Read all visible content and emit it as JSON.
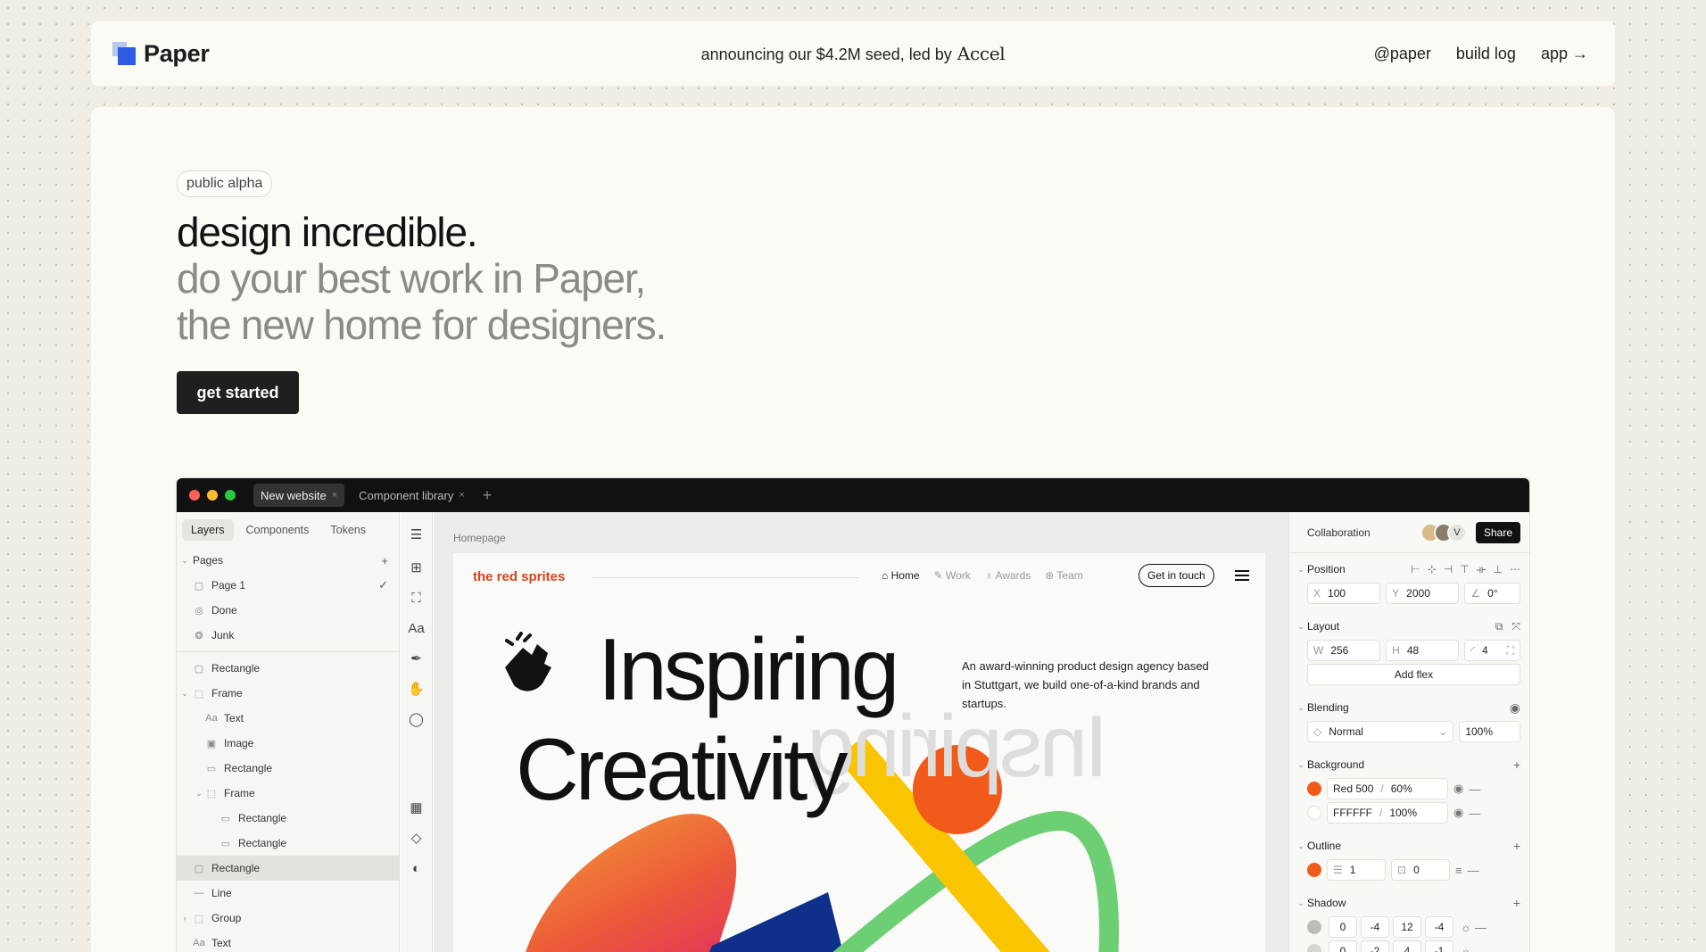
{
  "nav": {
    "brand": "Paper",
    "announce_text": "announcing our $4.2M seed, led by",
    "announce_brand": "Accel",
    "links": [
      "@paper",
      "build log",
      "app →"
    ]
  },
  "hero": {
    "badge": "public alpha",
    "line1": "design incredible.",
    "line2": "do your best work in Paper,",
    "line3": "the new home for designers.",
    "cta": "get started"
  },
  "app": {
    "tabs": [
      {
        "label": "New website",
        "close": "×"
      },
      {
        "label": "Component library",
        "close": "×"
      }
    ],
    "new_tab": "+",
    "left": {
      "tabs": [
        "Layers",
        "Components",
        "Tokens"
      ],
      "pages_header": "Pages",
      "pages_add": "+",
      "pages": [
        {
          "label": "Page 1",
          "check": "✓"
        },
        {
          "label": "Done"
        },
        {
          "label": "Junk"
        }
      ],
      "layers": [
        {
          "label": "Rectangle"
        },
        {
          "label": "Frame"
        },
        {
          "label": "Text"
        },
        {
          "label": "Image"
        },
        {
          "label": "Rectangle"
        },
        {
          "label": "Frame"
        },
        {
          "label": "Rectangle"
        },
        {
          "label": "Rectangle"
        },
        {
          "label": "Rectangle"
        },
        {
          "label": "Line"
        },
        {
          "label": "Group"
        },
        {
          "label": "Text"
        }
      ]
    },
    "tools": {
      "text_tool": "Aa"
    },
    "canvas": {
      "breadcrumb": "Homepage",
      "site_brand": "the red sprites",
      "site_nav": [
        "Home",
        "Work",
        "Awards",
        "Team"
      ],
      "site_cta": "Get in touch",
      "headline1": "Inspiring",
      "headline2": "Creativity",
      "ghost": "Inspiring",
      "description": "An award-winning product design agency based in Stuttgart, we build one-of-a-kind brands and startups."
    },
    "right": {
      "collab_title": "Collaboration",
      "avatar_initial": "V",
      "share": "Share",
      "position": {
        "title": "Position",
        "x_label": "X",
        "x": "100",
        "y_label": "Y",
        "y": "2000",
        "rotation": "0°"
      },
      "layout": {
        "title": "Layout",
        "w_label": "W",
        "w": "256",
        "h_label": "H",
        "h": "48",
        "radius": "4",
        "add_flex": "Add flex"
      },
      "blending": {
        "title": "Blending",
        "mode": "Normal",
        "opacity": "100%"
      },
      "background": {
        "title": "Background",
        "fills": [
          {
            "name": "Red 500",
            "opacity": "60%",
            "color": "#f05a1a"
          },
          {
            "name": "FFFFFF",
            "opacity": "100%",
            "color": "#ffffff"
          }
        ]
      },
      "outline": {
        "title": "Outline",
        "width": "1",
        "offset": "0",
        "color": "#f05a1a"
      },
      "shadow": {
        "title": "Shadow",
        "rows": [
          {
            "v": [
              "0",
              "-4",
              "12",
              "-4"
            ]
          },
          {
            "v": [
              "0",
              "-2",
              "4",
              "-1"
            ]
          }
        ]
      }
    }
  },
  "colors": {
    "accent": "#2b5ce3",
    "brand_red": "#d8431e",
    "orange": "#f05a1a",
    "yellow": "#f9c400",
    "green": "#6ccf74",
    "navy": "#0e2f8a"
  }
}
